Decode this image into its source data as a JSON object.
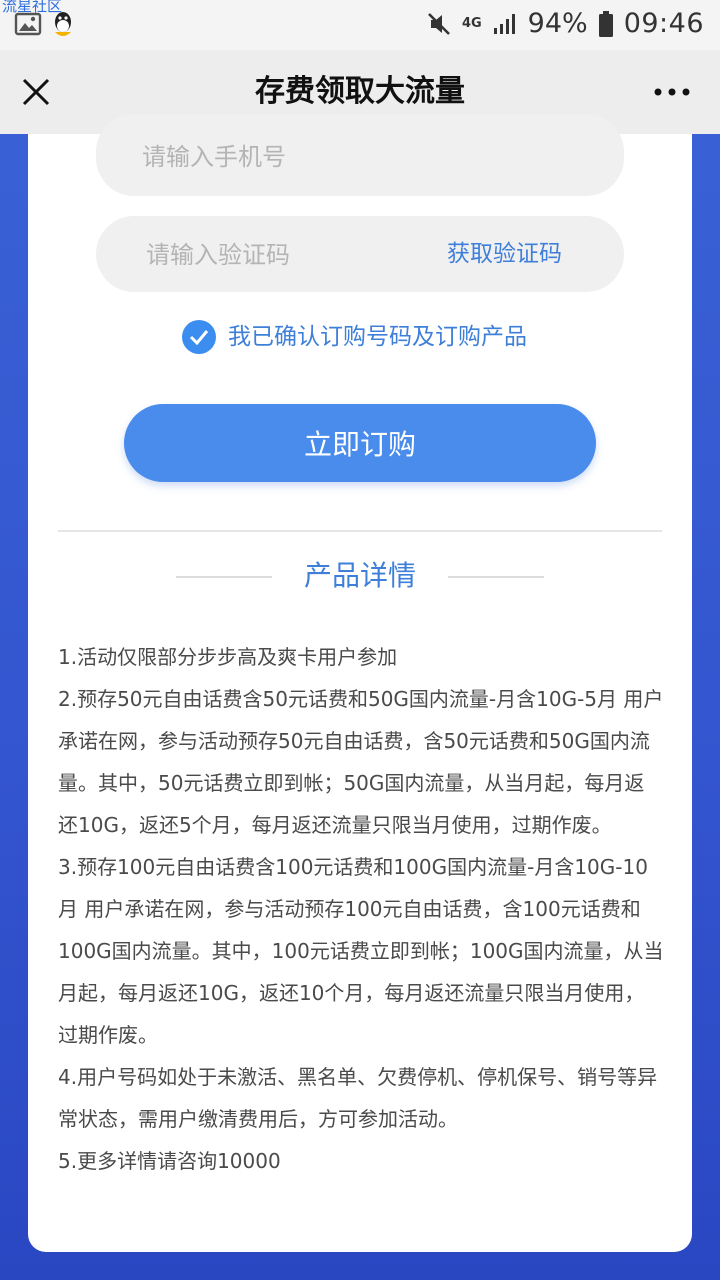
{
  "status_bar": {
    "watermark": "流星社区",
    "battery": "94%",
    "network": "4G",
    "time": "09:46"
  },
  "header": {
    "title": "存费领取大流量"
  },
  "form": {
    "phone_placeholder": "请输入手机号",
    "code_placeholder": "请输入验证码",
    "get_code_label": "获取验证码",
    "confirm_label": "我已确认订购号码及订购产品",
    "confirm_checked": true,
    "subscribe_label": "立即订购"
  },
  "details": {
    "title": "产品详情",
    "items": [
      "1.活动仅限部分步步高及爽卡用户参加",
      "2.预存50元自由话费含50元话费和50G国内流量-月含10G-5月 用户承诺在网，参与活动预存50元自由话费，含50元话费和50G国内流量。其中，50元话费立即到帐；50G国内流量，从当月起，每月返还10G，返还5个月，每月返还流量只限当月使用，过期作废。",
      "3.预存100元自由话费含100元话费和100G国内流量-月含10G-10月 用户承诺在网，参与活动预存100元自由话费，含100元话费和100G国内流量。其中，100元话费立即到帐；100G国内流量，从当月起，每月返还10G，返还10个月，每月返还流量只限当月使用，过期作废。",
      "4.用户号码如处于未激活、黑名单、欠费停机、停机保号、销号等异常状态，需用户缴清费用后，方可参加活动。",
      "5.更多详情请咨询10000"
    ]
  },
  "colors": {
    "accent": "#3e7fd9",
    "button": "#4a8cec",
    "background": "#3355cf"
  }
}
